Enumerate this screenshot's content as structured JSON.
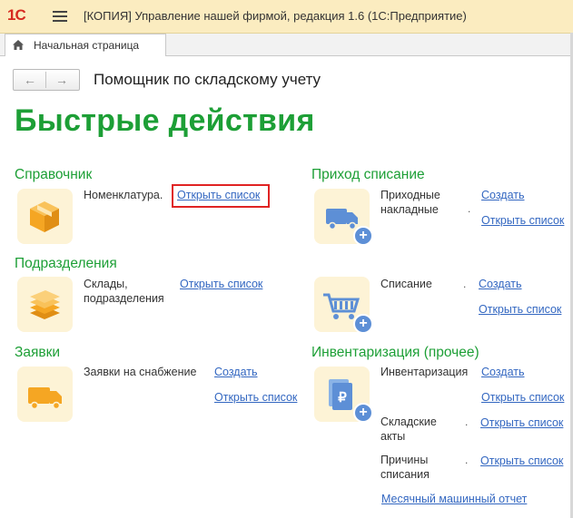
{
  "window": {
    "logo": "1С",
    "title": "[КОПИЯ] Управление нашей фирмой, редакция 1.6 (1С:Предприятие)"
  },
  "tabs": [
    {
      "label": "Начальная страница"
    }
  ],
  "nav": {
    "back": "←",
    "forward": "→"
  },
  "form": {
    "title": "Помощник по складскому учету",
    "heading": "Быстрые действия"
  },
  "sections": {
    "catalog": {
      "title": "Справочник",
      "item": "Номенклатура.",
      "open": "Открыть список"
    },
    "divisions": {
      "title": "Подразделения",
      "item_line1": "Склады,",
      "item_line2": "подразделения",
      "open": "Открыть список"
    },
    "requests": {
      "title": "Заявки",
      "item": "Заявки на снабжение",
      "create": "Создать",
      "open": "Открыть список"
    },
    "receipt": {
      "title": "Приход списание",
      "item1_line1": "Приходные",
      "item1_line2": "накладные",
      "create1": "Создать",
      "open1": "Открыть список",
      "item2": "Списание",
      "create2": "Создать",
      "open2": "Открыть список"
    },
    "inventory": {
      "title": "Инвентаризация (прочее)",
      "item1": "Инвентаризация",
      "create1": "Создать",
      "open1": "Открыть список",
      "item2_line1": "Складские",
      "item2_line2": "акты",
      "open2": "Открыть список",
      "item3_line1": "Причины",
      "item3_line2": "списания",
      "open3": "Открыть список",
      "report": "Месячный машинный отчет"
    }
  },
  "colors": {
    "accent_green": "#1d9f36",
    "link_blue": "#3367c1",
    "icon_orange": "#f5a623",
    "icon_blue": "#5d8fd6",
    "tile_bg": "#fdf3d6",
    "title_bar": "#fbecc0",
    "highlight_red": "#e02323"
  }
}
